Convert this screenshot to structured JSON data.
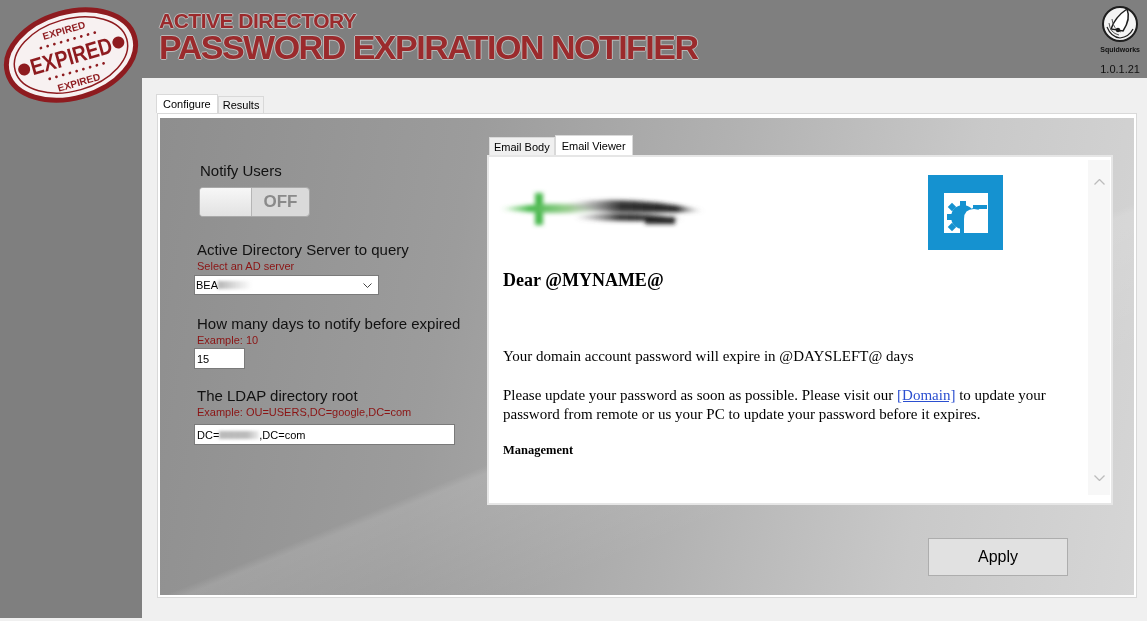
{
  "header": {
    "stamp": {
      "top_text": "EXPIRED",
      "center_text": "EXPIRED",
      "bottom_text": "EXPIRED"
    },
    "title_line_1": "ACTIVE DIRECTORY",
    "title_line_2": "PASSWORD EXPIRATION NOTIFIER",
    "brand": "Squidworks",
    "version": "1.0.1.21"
  },
  "tabs": [
    {
      "label": "Configure",
      "selected": true
    },
    {
      "label": "Results",
      "selected": false
    }
  ],
  "settings": {
    "notify_users": {
      "label": "Notify Users",
      "on": false,
      "state_text": "OFF"
    },
    "ad_server": {
      "label": "Active Directory Server to query",
      "hint": "Select an AD server",
      "value": "BEA",
      "redacted": true
    },
    "days": {
      "label": "How many days to notify before expired",
      "hint": "Example: 10",
      "value": "15"
    },
    "ldap_root": {
      "label": "The LDAP directory root",
      "hint": "Example: OU=USERS,DC=google,DC=com",
      "value": "DC=",
      "redacted": true,
      "value_end": ",DC=com"
    }
  },
  "email": {
    "tabs": [
      {
        "label": "Email Body",
        "selected": false
      },
      {
        "label": "Email Viewer",
        "selected": true
      }
    ],
    "greeting": "Dear @MYNAME@",
    "notice": "Your domain account password will expire in @DAYSLEFT@ days",
    "request": {
      "before": "Please update your password as soon as possible. Please visit our ",
      "link": "[Domain]",
      "after": " to update your password from remote or us your PC to update your password before it expires."
    },
    "signature": "Management"
  },
  "apply_button": "Apply"
}
